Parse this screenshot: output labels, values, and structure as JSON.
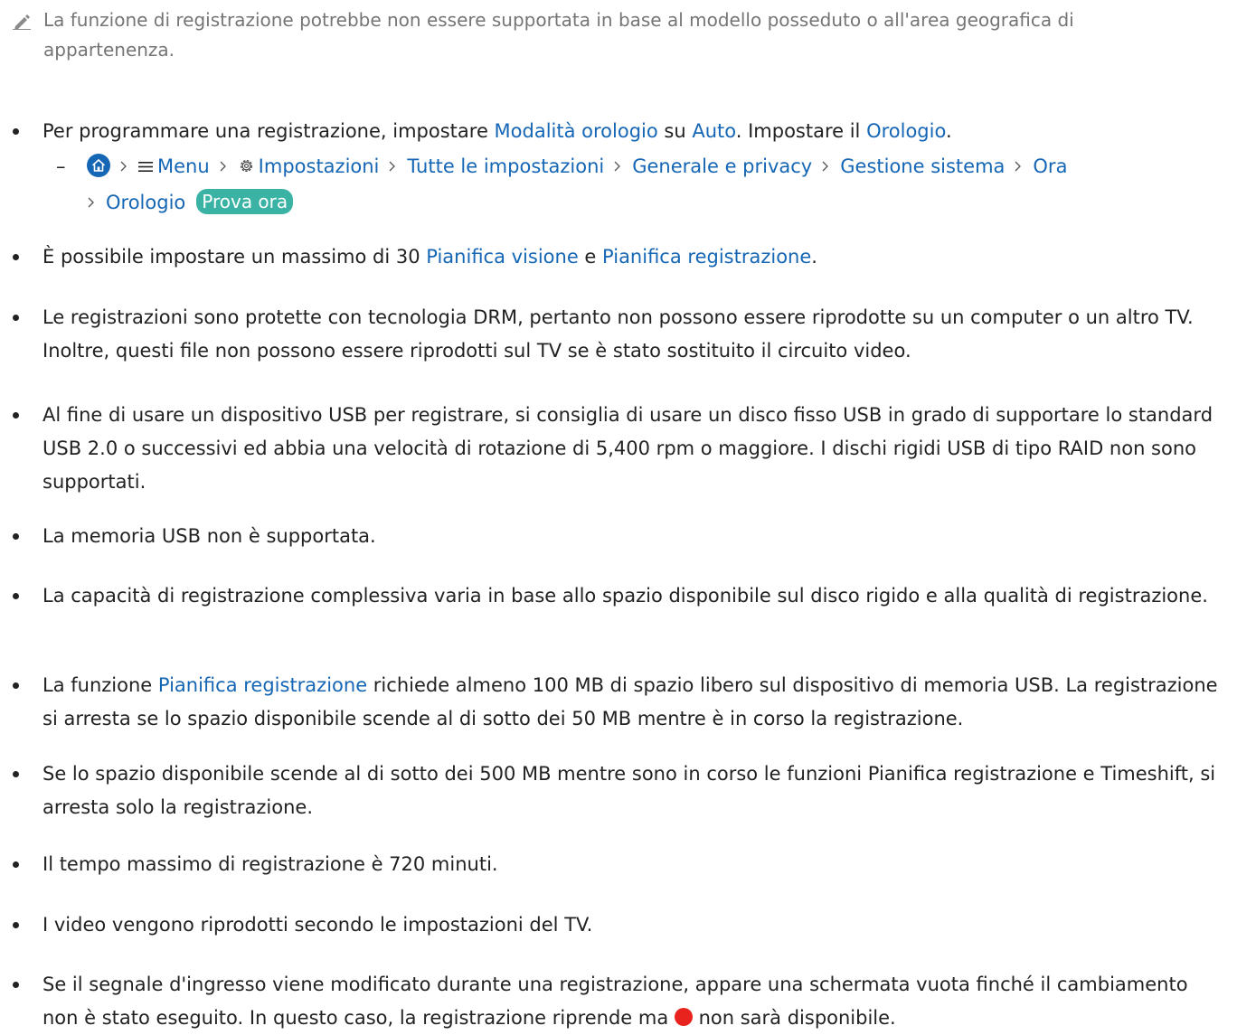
{
  "note": {
    "text": "La funzione di registrazione potrebbe non essere supportata in base al modello posseduto o all'area geografica di appartenenza.",
    "icon": "pencil-icon"
  },
  "items": [
    {
      "p1": "Per programmare una registrazione, impostare ",
      "l1": "Modalità orologio",
      "p2": " su ",
      "l2": "Auto",
      "p3": ". Impostare il ",
      "l3": "Orologio",
      "p4": "."
    },
    {
      "p1": "È possibile impostare un massimo di 30 ",
      "l1": "Pianifica visione",
      "p2": " e ",
      "l2": "Pianifica registrazione",
      "p3": "."
    },
    {
      "text": "Le registrazioni sono protette con tecnologia DRM, pertanto non possono essere riprodotte su un computer o un altro TV. Inoltre, questi file non possono essere riprodotti sul TV se è stato sostituito il circuito video."
    },
    {
      "text": "Al fine di usare un dispositivo USB per registrare, si consiglia di usare un disco fisso USB in grado di supportare lo standard USB 2.0 o successivi ed abbia una velocità di rotazione di 5,400 rpm o maggiore. I dischi rigidi USB di tipo RAID non sono supportati."
    },
    {
      "text": "La memoria USB non è supportata."
    },
    {
      "text": "La capacità di registrazione complessiva varia in base allo spazio disponibile sul disco rigido e alla qualità di registrazione."
    },
    {
      "p1": "La funzione ",
      "l1": "Pianifica registrazione",
      "p2": " richiede almeno 100 MB di spazio libero sul dispositivo di memoria USB. La registrazione si arresta se lo spazio disponibile scende al di sotto dei 50 MB mentre è in corso la registrazione."
    },
    {
      "text": "Se lo spazio disponibile scende al di sotto dei 500 MB mentre sono in corso le funzioni Pianifica registrazione e Timeshift, si arresta solo la registrazione."
    },
    {
      "text": "Il tempo massimo di registrazione è 720 minuti."
    },
    {
      "text": "I video vengono riprodotti secondo le impostazioni del TV."
    },
    {
      "p1": "Se il segnale d'ingresso viene modificato durante una registrazione, appare una schermata vuota finché il cambiamento non è stato eseguito. In questo caso, la registrazione riprende ma ",
      "p2": " non sarà disponibile.",
      "icon": "record-dot-icon"
    }
  ],
  "menu_path": {
    "dash": "–",
    "home_icon": "home-icon",
    "menu": "Menu",
    "settings": "Impostazioni",
    "all_settings": "Tutte le impostazioni",
    "general": "Generale e privacy",
    "system": "Gestione sistema",
    "time": "Ora",
    "clock": "Orologio",
    "try_now": "Prova ora"
  },
  "colors": {
    "link": "#1566b5",
    "text": "#222222",
    "note": "#757575",
    "badge": "#3ab3a5",
    "record": "#e8231d"
  }
}
